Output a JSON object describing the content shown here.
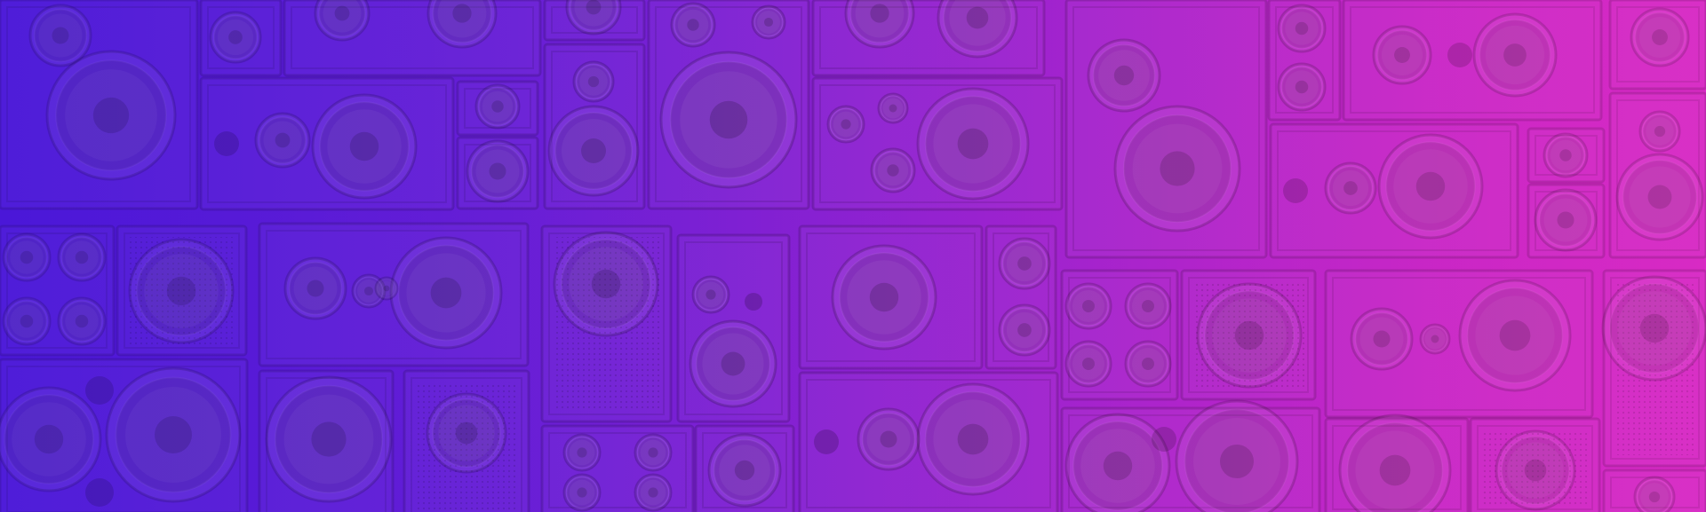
{
  "banner": {
    "description_name": "speaker-wall-background",
    "colors": {
      "gradient_start": "#4a17d8",
      "gradient_mid": "#9a22cf",
      "gradient_end": "#d82ac4"
    }
  }
}
